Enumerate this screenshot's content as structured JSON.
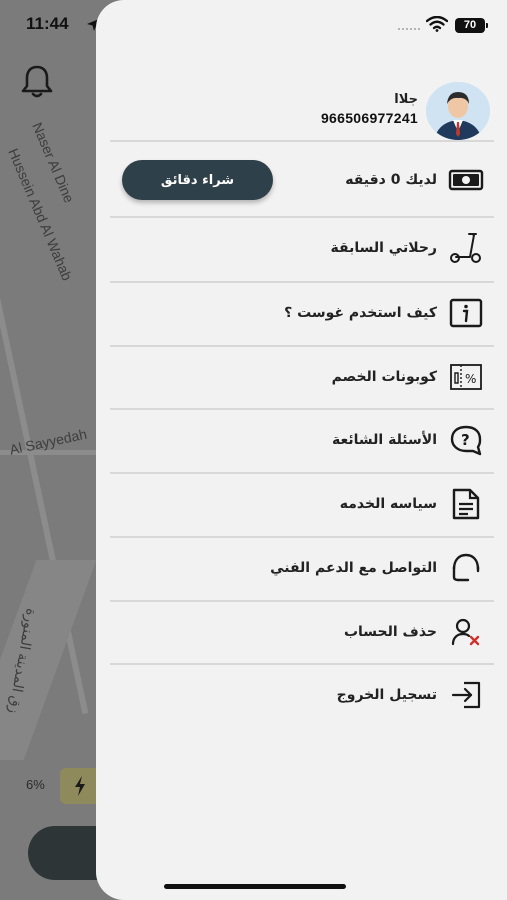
{
  "status_bar": {
    "time": "11:44",
    "battery_level": "70",
    "icons": [
      "location-arrow-icon",
      "cellular-dots-icon",
      "wifi-icon",
      "battery-icon"
    ]
  },
  "map": {
    "streets": [
      "Naser Al Dine",
      "Hussein Abd Al Wahab",
      "Al Sayyedah",
      "زق المدينة المنورة"
    ],
    "scooter_battery": "6%",
    "icons": [
      "bell-icon",
      "bolt-icon"
    ]
  },
  "drawer": {
    "profile": {
      "name": "جلاا",
      "phone": "966506977241"
    },
    "balance": {
      "label": "لديك 0 دقيقه",
      "buy_button": "شراء دقائق",
      "icon": "cash-icon"
    },
    "menu": [
      {
        "label": "رحلاتي السابقة",
        "icon": "scooter-icon"
      },
      {
        "label": "كيف استخدم غوست ؟",
        "icon": "info-icon"
      },
      {
        "label": "كوبونات الخصم",
        "icon": "coupon-icon"
      },
      {
        "label": "الأسئلة الشائعة",
        "icon": "question-bubble-icon"
      },
      {
        "label": "سياسه الخدمه",
        "icon": "document-icon"
      },
      {
        "label": "التواصل مع الدعم الفني",
        "icon": "headset-icon"
      },
      {
        "label": "حذف الحساب",
        "icon": "user-remove-icon"
      },
      {
        "label": "تسجيل الخروج",
        "icon": "logout-icon"
      }
    ]
  }
}
